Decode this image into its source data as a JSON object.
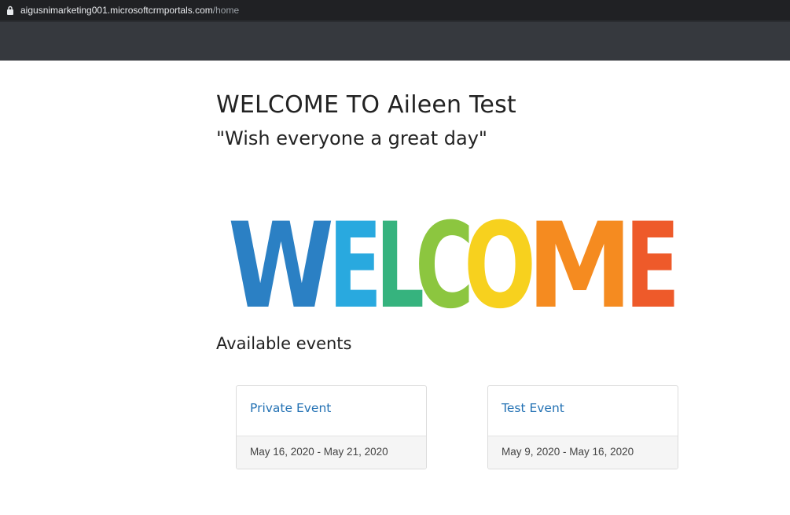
{
  "browser": {
    "url_host": "aigusnimarketing001.microsoftcrmportals.com",
    "url_path": "/home"
  },
  "page": {
    "title": "WELCOME TO Aileen Test",
    "subtitle": "\"Wish everyone a great day\"",
    "banner_letters": [
      "W",
      "E",
      "L",
      "C",
      "O",
      "M",
      "E"
    ],
    "banner_colors": [
      "#2b80c4",
      "#29a9df",
      "#36b37e",
      "#8cc63f",
      "#f7d11e",
      "#f58b20",
      "#ee5a2a"
    ],
    "events_heading": "Available events"
  },
  "events": [
    {
      "name": "Private Event",
      "dates": "May 16, 2020 - May 21, 2020"
    },
    {
      "name": "Test Event",
      "dates": "May 9, 2020 - May 16, 2020"
    }
  ],
  "colors": {
    "link": "#2472b4",
    "navbar": "#36393e",
    "address_bar": "#202124"
  }
}
